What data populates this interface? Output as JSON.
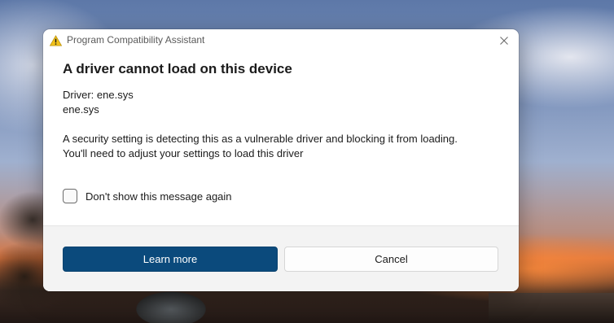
{
  "window": {
    "title": "Program Compatibility Assistant",
    "close_icon": "close-icon",
    "title_icon": "warning-icon"
  },
  "content": {
    "heading": "A driver cannot load on this device",
    "driver_line": "Driver: ene.sys",
    "driver_file": "ene.sys",
    "message_line1": "A security setting is detecting this as a vulnerable driver and blocking it from loading.",
    "message_line2": "You'll need to adjust your settings to load this driver"
  },
  "checkbox": {
    "label": "Don't show this message again",
    "checked": false
  },
  "buttons": {
    "learn_more": "Learn more",
    "cancel": "Cancel"
  },
  "colors": {
    "primary_button": "#0b4a7c",
    "warning_icon": "#f2c21b"
  }
}
